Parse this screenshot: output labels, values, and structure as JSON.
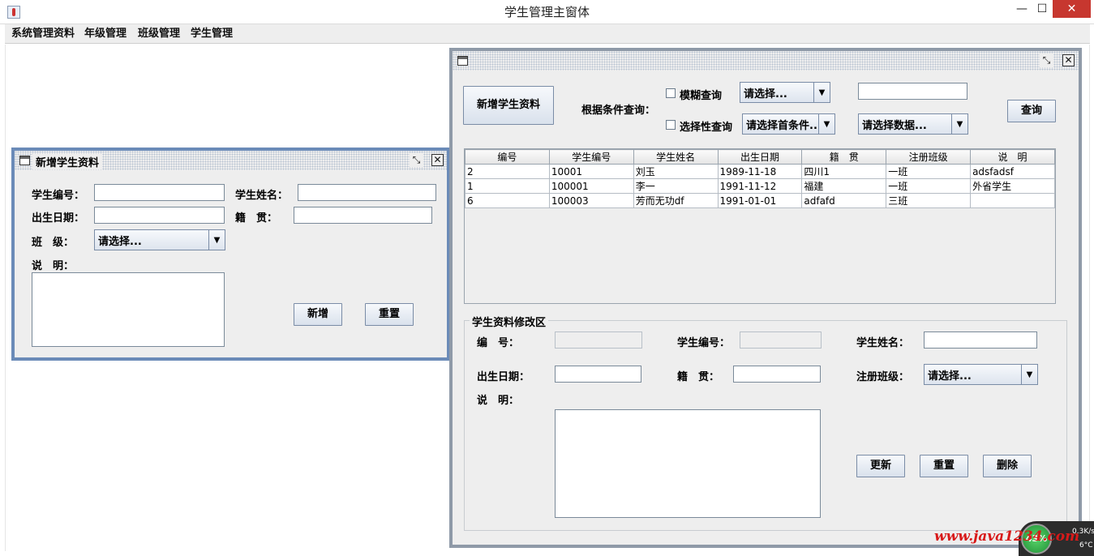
{
  "window": {
    "title": "学生管理主窗体",
    "minimize_glyph": "—",
    "maximize_glyph": "☐",
    "close_glyph": "✕"
  },
  "menu": [
    "系统管理资料",
    "年级管理",
    "班级管理",
    "学生管理"
  ],
  "add_frame": {
    "title": "新增学生资料",
    "labels": {
      "student_no": "学生编号：",
      "student_name": "学生姓名：",
      "birth_date": "出生日期：",
      "native_place": "籍　贯：",
      "class": "班　级：",
      "remark": "说　明："
    },
    "values": {
      "student_no": "",
      "student_name": "",
      "birth_date": "",
      "native_place": "",
      "remark": ""
    },
    "class_select": "请选择...",
    "buttons": {
      "add": "新增",
      "reset": "重置"
    }
  },
  "query_frame": {
    "new_button": "新增学生资料",
    "condition_label": "根据条件查询：",
    "fuzzy_label": "模糊查询",
    "fuzzy_checked": false,
    "fuzzy_select": "请选择...",
    "fuzzy_input": "",
    "selective_label": "选择性查询",
    "selective_checked": false,
    "first_condition_select": "请选择首条件...",
    "data_select": "请选择数据...",
    "query_button": "查询",
    "table": {
      "columns": [
        "编号",
        "学生编号",
        "学生姓名",
        "出生日期",
        "籍　贯",
        "注册班级",
        "说　明"
      ],
      "rows": [
        [
          "2",
          "10001",
          "刘玉",
          "1989-11-18",
          "四川1",
          "一班",
          "adsfadsf"
        ],
        [
          "1",
          "100001",
          "李一",
          "1991-11-12",
          "福建",
          "一班",
          "外省学生"
        ],
        [
          "6",
          "100003",
          "芳而无功df",
          "1991-01-01",
          "adfafd",
          "三班",
          ""
        ]
      ]
    },
    "edit_area": {
      "legend": "学生资料修改区",
      "labels": {
        "id": "编　号：",
        "student_no": "学生编号：",
        "student_name": "学生姓名：",
        "birth_date": "出生日期：",
        "native_place": "籍　贯：",
        "class": "注册班级：",
        "remark": "说　明："
      },
      "values": {
        "id": "",
        "student_no": "",
        "student_name": "",
        "birth_date": "",
        "native_place": "",
        "remark": ""
      },
      "class_select": "请选择...",
      "buttons": {
        "update": "更新",
        "reset": "重置",
        "delete": "删除"
      }
    }
  },
  "system_tray": {
    "watermark": "www.java1234.com",
    "cpu_percent": "43%",
    "net_speed": "0.3K/s",
    "temperature": "6°C"
  }
}
